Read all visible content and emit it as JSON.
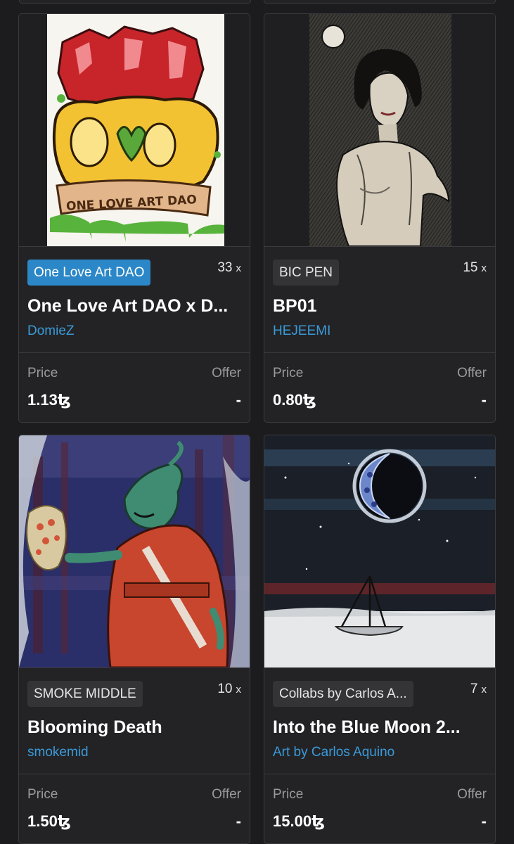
{
  "labels": {
    "price": "Price",
    "offer": "Offer",
    "edition_suffix": "x"
  },
  "cards": [
    {
      "collection": "One Love Art DAO",
      "editions": "33",
      "title": "One Love Art DAO x D...",
      "artist": "DomieZ",
      "price": "1.13ꜩ",
      "offer": "-"
    },
    {
      "collection": "BIC PEN",
      "editions": "15",
      "title": "BP01",
      "artist": "HEJEEMI",
      "price": "0.80ꜩ",
      "offer": "-"
    },
    {
      "collection": "SMOKE MIDDLE",
      "editions": "10",
      "title": "Blooming Death",
      "artist": "smokemid",
      "price": "1.50ꜩ",
      "offer": "-"
    },
    {
      "collection": "Collabs by Carlos A...",
      "editions": "7",
      "title": "Into the Blue Moon 2...",
      "artist": "Art by Carlos Aquino",
      "price": "15.00ꜩ",
      "offer": "-"
    }
  ],
  "colors": {
    "background": "#1c1c1e",
    "card": "#232325",
    "accent_link": "#3a9ad9",
    "badge_highlight": "#2b87c7"
  }
}
